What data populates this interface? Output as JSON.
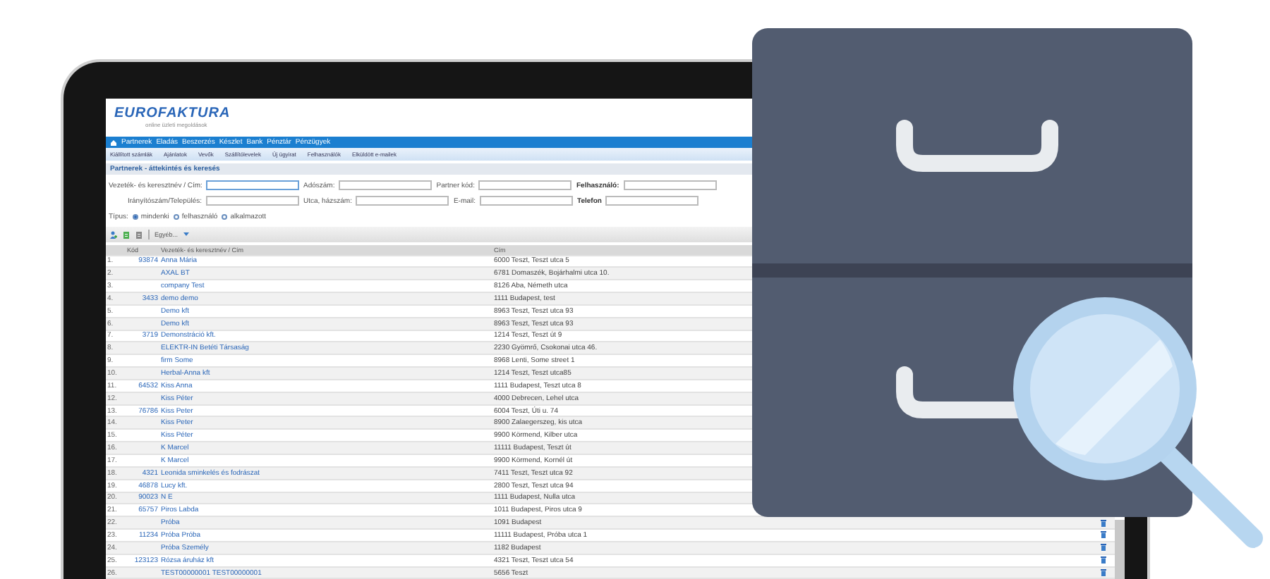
{
  "logo": {
    "brand": "EUROFAKTURA",
    "tagline": "online üzleti megoldások"
  },
  "main_menu": [
    "Partnerek",
    "Eladás",
    "Beszerzés",
    "Készlet",
    "Bank",
    "Pénztár",
    "Pénzügyek"
  ],
  "sub_menu": [
    "Kiállított számlák",
    "Ajánlatok",
    "Vevők",
    "Szállítólevelek",
    "Új ügyirat",
    "Felhasználók",
    "Elküldött e-mailek"
  ],
  "page_title": "Partnerek - áttekintés és keresés",
  "search_form": {
    "rows": [
      {
        "fields": [
          {
            "label": "Vezeték- és keresztnév / Cím:",
            "focused": true,
            "bold": false
          },
          {
            "label": "Adószám:",
            "focused": false,
            "bold": false
          },
          {
            "label": "Partner kód:",
            "focused": false,
            "bold": false
          },
          {
            "label": "Felhasználó:",
            "focused": false,
            "bold": true
          }
        ]
      },
      {
        "fields": [
          {
            "label": "Irányítószám/Település:",
            "focused": false,
            "bold": false
          },
          {
            "label": "Utca, házszám:",
            "focused": false,
            "bold": false
          },
          {
            "label": "E-mail:",
            "focused": false,
            "bold": false
          },
          {
            "label": "Telefon",
            "focused": false,
            "bold": true
          }
        ]
      }
    ],
    "type_label": "Típus:",
    "type_options": [
      {
        "label": "mindenki",
        "selected": true
      },
      {
        "label": "felhasználó",
        "selected": false
      },
      {
        "label": "alkalmazott",
        "selected": false
      }
    ]
  },
  "toolbar": {
    "more": "Egyéb..."
  },
  "table": {
    "columns": [
      "Kód",
      "Vezeték- és keresztnév / Cím",
      "Cím"
    ],
    "rows": [
      {
        "index": "1.",
        "code": "93874",
        "name": "Anna Mária",
        "address": "6000 Teszt, Teszt utca 5"
      },
      {
        "index": "2.",
        "code": "",
        "name": "AXAL BT",
        "address": "6781 Domaszék, Bojárhalmi utca 10."
      },
      {
        "index": "3.",
        "code": "",
        "name": "company Test",
        "address": "8126 Aba, Németh utca"
      },
      {
        "index": "4.",
        "code": "3433",
        "name": "demo demo",
        "address": "1111 Budapest, test"
      },
      {
        "index": "5.",
        "code": "",
        "name": "Demo kft",
        "address": "8963 Teszt, Teszt utca 93"
      },
      {
        "index": "6.",
        "code": "",
        "name": "Demo kft",
        "address": "8963 Teszt, Teszt utca 93"
      },
      {
        "index": "7.",
        "code": "3719",
        "name": "Demonstráció kft.",
        "address": "1214 Teszt, Teszt út 9"
      },
      {
        "index": "8.",
        "code": "",
        "name": "ELEKTR-IN Betéti Társaság",
        "address": "2230 Gyömrő, Csokonai utca 46."
      },
      {
        "index": "9.",
        "code": "",
        "name": "firm Some",
        "address": "8968 Lenti, Some street 1"
      },
      {
        "index": "10.",
        "code": "",
        "name": "Herbal-Anna kft",
        "address": "1214 Teszt, Teszt utca85"
      },
      {
        "index": "11.",
        "code": "64532",
        "name": "Kiss Anna",
        "address": "1111 Budapest, Teszt utca 8"
      },
      {
        "index": "12.",
        "code": "",
        "name": "Kiss Péter",
        "address": "4000 Debrecen, Lehel utca"
      },
      {
        "index": "13.",
        "code": "76786",
        "name": "Kiss Peter",
        "address": "6004 Teszt, Úti u. 74"
      },
      {
        "index": "14.",
        "code": "",
        "name": "Kiss Peter",
        "address": "8900 Zalaegerszeg, kis utca"
      },
      {
        "index": "15.",
        "code": "",
        "name": "Kiss Péter",
        "address": "9900 Körmend, Kilber utca"
      },
      {
        "index": "16.",
        "code": "",
        "name": "K Marcel",
        "address": "11111 Budapest, Teszt út"
      },
      {
        "index": "17.",
        "code": "",
        "name": "K Marcel",
        "address": "9900 Körmend, Kornél út"
      },
      {
        "index": "18.",
        "code": "4321",
        "name": "Leonida sminkelés és fodrászat",
        "address": "7411 Teszt, Teszt utca 92"
      },
      {
        "index": "19.",
        "code": "46878",
        "name": "Lucy kft.",
        "address": "2800 Teszt, Teszt utca 94"
      },
      {
        "index": "20.",
        "code": "90023",
        "name": "N E",
        "address": "1111 Budapest, Nulla utca"
      },
      {
        "index": "21.",
        "code": "65757",
        "name": "Piros Labda",
        "address": "1011 Budapest, Piros utca 9"
      },
      {
        "index": "22.",
        "code": "",
        "name": "Próba",
        "address": "1091 Budapest",
        "trash": true
      },
      {
        "index": "23.",
        "code": "11234",
        "name": "Próba Próba",
        "address": "11111 Budapest, Próba utca 1",
        "trash": true
      },
      {
        "index": "24.",
        "code": "",
        "name": "Próba Személy",
        "address": "1182 Budapest",
        "trash": true
      },
      {
        "index": "25.",
        "code": "123123",
        "name": "Rózsa áruház kft",
        "address": "4321 Teszt, Teszt utca 54",
        "trash": true
      },
      {
        "index": "26.",
        "code": "",
        "name": "TEST00000001 TEST00000001",
        "address": "5656 Teszt",
        "trash": true
      }
    ]
  }
}
